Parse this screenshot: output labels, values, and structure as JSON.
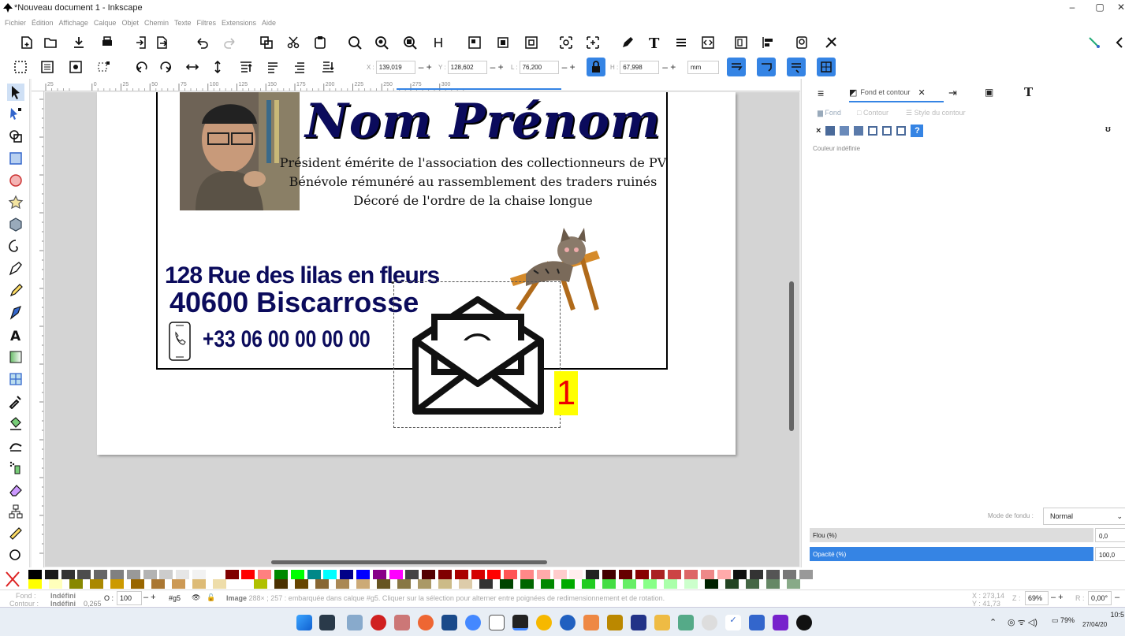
{
  "window": {
    "title": "*Nouveau document 1 - Inkscape"
  },
  "menu": [
    "Fichier",
    "Édition",
    "Affichage",
    "Calque",
    "Objet",
    "Chemin",
    "Texte",
    "Filtres",
    "Extensions",
    "Aide"
  ],
  "toolbar2": {
    "x_label": "X :",
    "x_value": "139,019",
    "y_label": "Y :",
    "y_value": "128,602",
    "l_label": "L :",
    "l_value": "76,200",
    "h_label": "H :",
    "h_value": "67,998",
    "unit": "mm"
  },
  "ruler_ticks": [
    "25",
    "0",
    "25",
    "50",
    "75",
    "100",
    "125",
    "150",
    "175",
    "200",
    "225",
    "250",
    "275",
    "300"
  ],
  "card": {
    "name": "Nom Prénom",
    "line1": "Président émérite de l'association des collectionneurs de PV",
    "line2": "Bénévole rémunéré au rassemblement des traders ruinés",
    "line3": "Décoré de l'ordre de la chaise longue",
    "address1": "128 Rue des lilas en fleurs",
    "address2": "40600  Biscarrosse",
    "phone": "+33 06 00 00 00 00",
    "badge": "1"
  },
  "dock": {
    "tab_fill_stroke": "Fond et contour",
    "sub_fill": "Fond",
    "sub_stroke": "Contour",
    "sub_stroke_style": "Style du contour",
    "undefined_color": "Couleur indéfinie",
    "blend_label": "Mode de fondu :",
    "blend_value": "Normal",
    "blur_label": "Flou (%)",
    "blur_value": "0,0",
    "opacity_label": "Opacité (%)",
    "opacity_value": "100,0"
  },
  "status": {
    "fill_label": "Fond :",
    "fill_value": "Indéfini",
    "stroke_label": "Contour :",
    "stroke_value": "Indéfini",
    "stroke_width": "0,265",
    "opacity_label": "O :",
    "opacity_value": "100",
    "layer": "#g5",
    "message_bold": "Image",
    "message": " 288× ; 257 : embarquée dans calque #g5. Cliquer sur la sélection pour alterner entre poignées de redimensionnement et de rotation.",
    "x_coord": "273,14",
    "y_coord": "41,73",
    "zoom": "69%",
    "rotation": "0,00°"
  },
  "taskbar": {
    "battery": "79%",
    "time": "10:5",
    "date": "27/04/20"
  },
  "colors": {
    "accent": "#3584e4",
    "navy_text": "#0b0b5c",
    "badge_bg": "#ffff00",
    "badge_fg": "#e00000"
  }
}
